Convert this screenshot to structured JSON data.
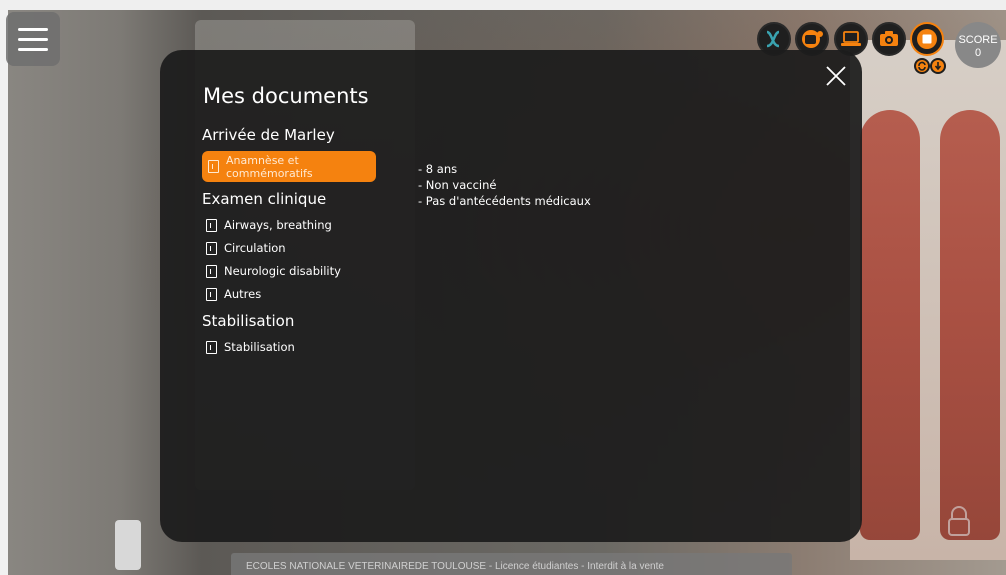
{
  "modal": {
    "title": "Mes documents",
    "sections": [
      {
        "title": "Arrivée de Marley",
        "items": [
          {
            "label": "Anamnèse et commémoratifs",
            "active": true
          }
        ]
      },
      {
        "title": "Examen clinique",
        "items": [
          {
            "label": "Airways, breathing"
          },
          {
            "label": "Circulation"
          },
          {
            "label": "Neurologic disability"
          },
          {
            "label": "Autres"
          }
        ]
      },
      {
        "title": "Stabilisation",
        "items": [
          {
            "label": "Stabilisation"
          }
        ]
      }
    ],
    "content_lines": [
      "- 8 ans",
      "- Non vacciné",
      "- Pas d'antécédents médicaux"
    ]
  },
  "toolbar": {
    "score_label": "SCORE",
    "score_value": "0",
    "tools": [
      "formula-icon",
      "camera-cut-icon",
      "laptop-icon",
      "photo-camera-icon",
      "stop-icon"
    ]
  },
  "footer": {
    "text": "ECOLES NATIONALE VETERINAIREDE TOULOUSE - Licence étudiantes - Interdit à la vente"
  },
  "colors": {
    "accent": "#f5820f",
    "modal_bg": "#1c1c1c",
    "teal_icon": "#3aa3b0"
  }
}
